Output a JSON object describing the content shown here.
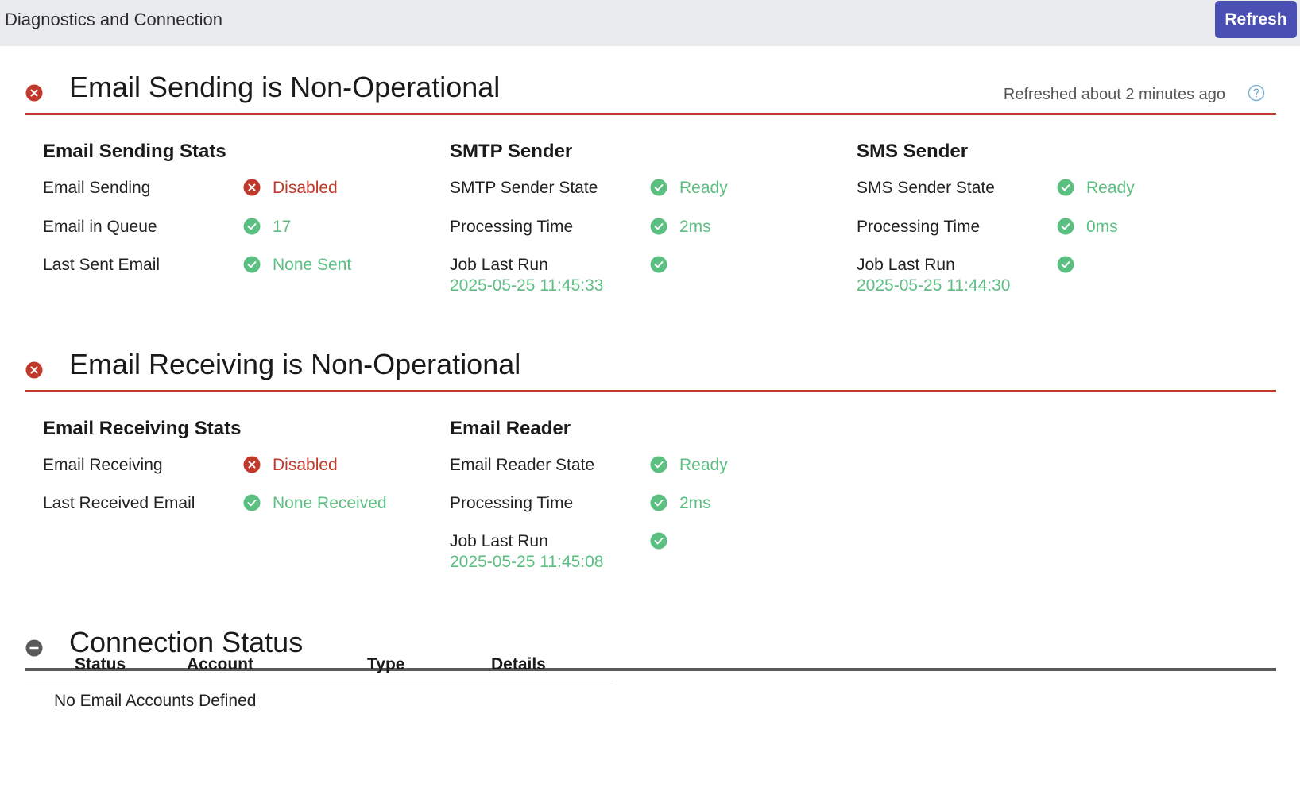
{
  "header": {
    "title": "Diagnostics and Connection",
    "refresh_label": "Refresh"
  },
  "sending": {
    "title": "Email Sending is Non-Operational",
    "refreshed": "Refreshed about 2 minutes ago",
    "status": "error",
    "stats": {
      "title": "Email Sending Stats",
      "rows": [
        {
          "label": "Email Sending",
          "value": "Disabled",
          "status": "error"
        },
        {
          "label": "Email in Queue",
          "value": "17",
          "status": "ok"
        },
        {
          "label": "Last Sent Email",
          "value": "None Sent",
          "status": "ok"
        }
      ]
    },
    "smtp": {
      "title": "SMTP Sender",
      "rows": [
        {
          "label": "SMTP Sender State",
          "value": "Ready",
          "status": "ok"
        },
        {
          "label": "Processing Time",
          "value": "2ms",
          "status": "ok"
        },
        {
          "label": "Job Last Run",
          "sub": "2025-05-25 11:45:33",
          "status": "ok"
        }
      ]
    },
    "sms": {
      "title": "SMS Sender",
      "rows": [
        {
          "label": "SMS Sender State",
          "value": "Ready",
          "status": "ok"
        },
        {
          "label": "Processing Time",
          "value": "0ms",
          "status": "ok"
        },
        {
          "label": "Job Last Run",
          "sub": "2025-05-25 11:44:30",
          "status": "ok"
        }
      ]
    }
  },
  "receiving": {
    "title": "Email Receiving is Non-Operational",
    "status": "error",
    "stats": {
      "title": "Email Receiving Stats",
      "rows": [
        {
          "label": "Email Receiving",
          "value": "Disabled",
          "status": "error"
        },
        {
          "label": "Last Received Email",
          "value": "None Received",
          "status": "ok"
        }
      ]
    },
    "reader": {
      "title": "Email Reader",
      "rows": [
        {
          "label": "Email Reader State",
          "value": "Ready",
          "status": "ok"
        },
        {
          "label": "Processing Time",
          "value": "2ms",
          "status": "ok"
        },
        {
          "label": "Job Last Run",
          "sub": "2025-05-25 11:45:08",
          "status": "ok"
        }
      ]
    }
  },
  "connection": {
    "title": "Connection Status",
    "status": "neutral",
    "columns": [
      "Status",
      "Account",
      "Type",
      "Details"
    ],
    "empty_message": "No Email Accounts Defined"
  },
  "colors": {
    "ok": "#5cbf82",
    "error": "#c0392b",
    "neutral": "#5a5a5a",
    "accent": "#4a4fb3"
  },
  "icons": {
    "ok": "check-circle-icon",
    "error": "x-circle-icon",
    "neutral": "minus-circle-icon",
    "help": "question-circle-icon"
  }
}
